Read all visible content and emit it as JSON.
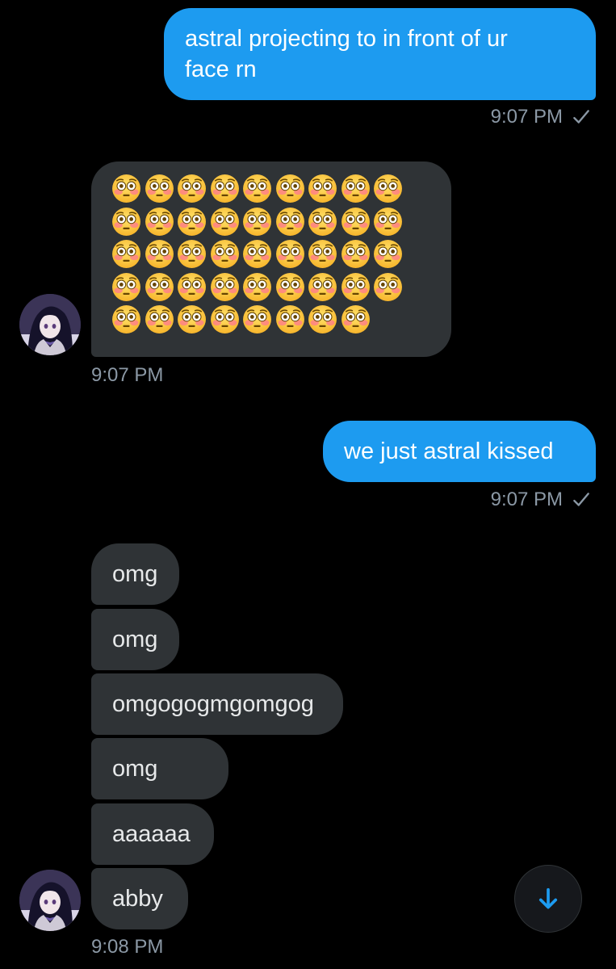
{
  "conversation": {
    "messages": [
      {
        "direction": "sent",
        "text": "astral projecting to in front of ur face rn",
        "line1": "astral projecting to in front of ur",
        "line2": "face rn"
      },
      {
        "direction": "received",
        "text": "😳😳😳😳😳😳😳😳😳 ×4 rows + 😳😳😳😳😳😳😳😳",
        "emoji_name": "flushed-face",
        "emoji_rows": [
          9,
          9,
          9,
          9,
          8
        ]
      },
      {
        "direction": "sent",
        "text": "we just astral kissed"
      },
      {
        "direction": "received",
        "text": "omg"
      },
      {
        "direction": "received",
        "text": "omg"
      },
      {
        "direction": "received",
        "text": "omgogogmgomgog"
      },
      {
        "direction": "received",
        "text": "omg"
      },
      {
        "direction": "received",
        "text": "aaaaaa"
      },
      {
        "direction": "received",
        "text": "abby"
      }
    ],
    "timestamps": {
      "t1": "9:07 PM",
      "t2": "9:07 PM",
      "t3": "9:07 PM",
      "t4": "9:08 PM"
    }
  },
  "icons": {
    "read_receipt": "checkmark-icon",
    "scroll_down": "arrow-down-icon",
    "emoji": "flushed-face-emoji"
  },
  "colors": {
    "background": "#000000",
    "sent_bubble": "#1d9bf0",
    "received_bubble": "#2f3336",
    "timestamp": "#8b98a5",
    "accent": "#1d9bf0"
  }
}
